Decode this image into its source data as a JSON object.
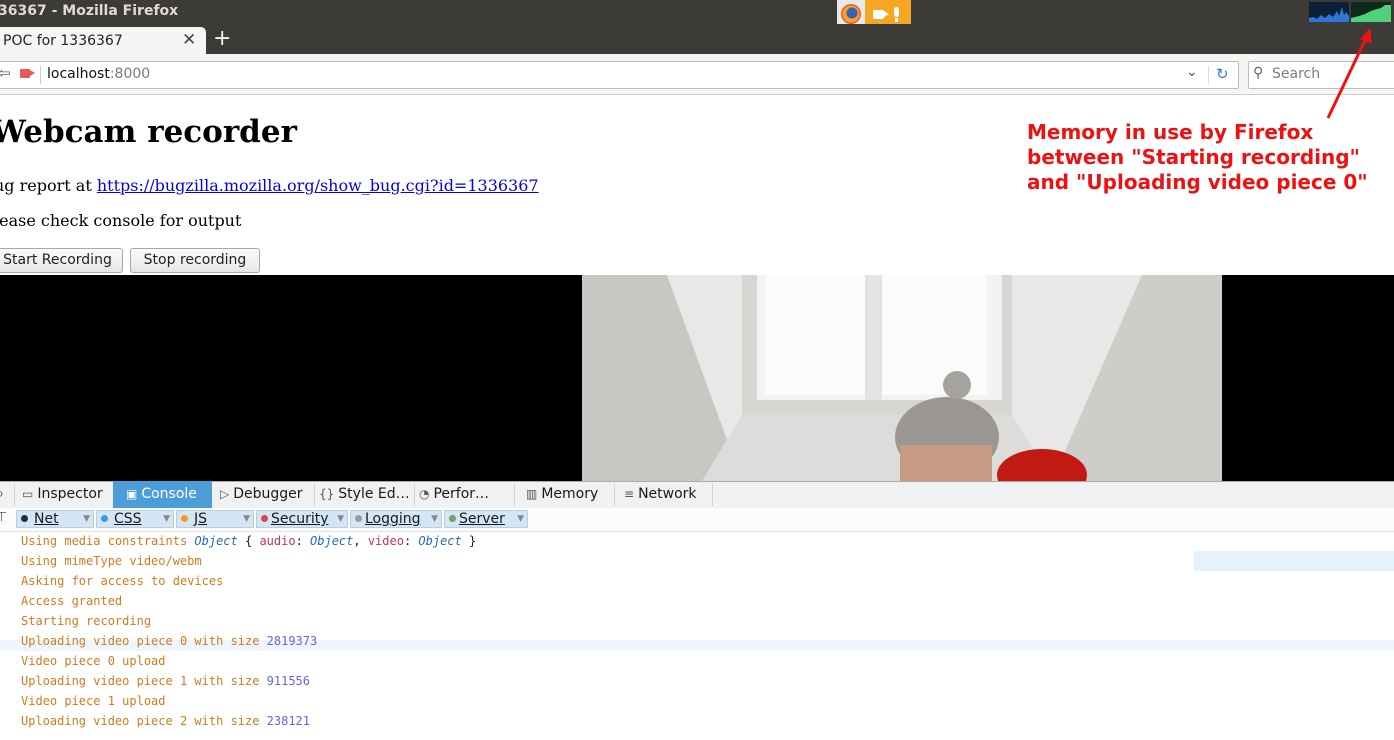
{
  "window": {
    "title": "36367 - Mozilla Firefox"
  },
  "tab": {
    "title": "POC for 1336367",
    "close": "✕",
    "new_tab": "+"
  },
  "urlbar": {
    "host": "localhost",
    "port": ":8000"
  },
  "search": {
    "placeholder": "Search"
  },
  "page": {
    "heading": "Webcam recorder",
    "bug_prefix": "ug report at ",
    "bug_link": "https://bugzilla.mozilla.org/show_bug.cgi?id=1336367",
    "console_note": "lease check console for output",
    "start_button": "Start Recording",
    "stop_button": "Stop recording"
  },
  "annotation": {
    "lines": [
      "Memory in use by Firefox",
      "between \"Starting recording\"",
      "and \"Uploading video piece 0\""
    ],
    "color": "#ee1111"
  },
  "devtools": {
    "tabs": [
      {
        "label": "Inspector",
        "icon": "inspector-icon"
      },
      {
        "label": "Console",
        "icon": "console-icon",
        "selected": true
      },
      {
        "label": "Debugger",
        "icon": "debugger-icon"
      },
      {
        "label": "Style Ed…",
        "icon": "style-editor-icon"
      },
      {
        "label": "Perfor…",
        "icon": "performance-icon"
      },
      {
        "label": "Memory",
        "icon": "memory-icon"
      },
      {
        "label": "Network",
        "icon": "network-icon"
      }
    ],
    "filters": [
      {
        "label": "Net",
        "color": "#2b2b2b"
      },
      {
        "label": "CSS",
        "color": "#3b9be0"
      },
      {
        "label": "JS",
        "color": "#f39a26"
      },
      {
        "label": "Security",
        "color": "#e0454e"
      },
      {
        "label": "Logging",
        "color": "#9b9b9b"
      },
      {
        "label": "Server",
        "color": "#6da66d"
      }
    ]
  },
  "console": {
    "constraints_prefix": "Using media constraints ",
    "constraints_obj": "Object",
    "constraints_open": " { ",
    "constraints_audio_key": "audio",
    "constraints_colon1": ": ",
    "constraints_audio_val": "Object",
    "constraints_comma": ", ",
    "constraints_video_key": "video",
    "constraints_colon2": ": ",
    "constraints_video_val": "Object",
    "constraints_close": " }",
    "lines": [
      {
        "text": "Using mimeType video/webm",
        "num": ""
      },
      {
        "text": "Asking for access to devices",
        "num": ""
      },
      {
        "text": "Access granted",
        "num": ""
      },
      {
        "text": "Starting recording",
        "num": ""
      },
      {
        "text": "Uploading video piece 0 with size ",
        "num": "2819373"
      },
      {
        "text": "Video piece 0 upload",
        "num": ""
      },
      {
        "text": "Uploading video piece 1 with size ",
        "num": "911556"
      },
      {
        "text": "Video piece 1 upload",
        "num": ""
      },
      {
        "text": "Uploading video piece 2 with size ",
        "num": "238121"
      }
    ]
  }
}
